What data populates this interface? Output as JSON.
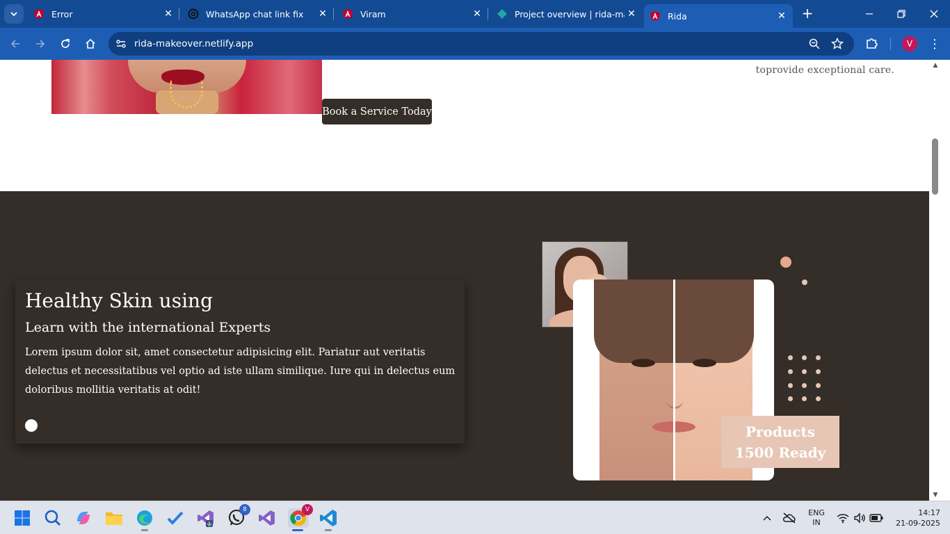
{
  "browser": {
    "tabs": [
      {
        "title": "Error",
        "favicon": "angular-icon",
        "active": false
      },
      {
        "title": "WhatsApp chat link fix",
        "favicon": "openai-icon",
        "active": false
      },
      {
        "title": "Viram",
        "favicon": "angular-icon",
        "active": false
      },
      {
        "title": "Project overview | rida-make",
        "favicon": "netlify-icon",
        "active": false
      },
      {
        "title": "Rida",
        "favicon": "angular-icon",
        "active": true
      }
    ],
    "url": "rida-makeover.netlify.app",
    "profile_initial": "V"
  },
  "page": {
    "book_button": "Book a Service Today",
    "care_text": "toprovide exceptional care.",
    "feature": {
      "title": "Healthy Skin using",
      "subtitle": "Learn with the international Experts",
      "body": "Lorem ipsum dolor sit, amet consectetur adipisicing elit. Pariatur aut veritatis delectus et necessitatibus vel optio ad iste ullam similique. Iure qui in delectus eum doloribus mollitia veritatis at odit!"
    },
    "badge": {
      "line1": "Products",
      "line2": "1500 Ready"
    },
    "colors": {
      "dark_bg": "#342d28",
      "accent_peach": "#e7c6b6"
    }
  },
  "taskbar": {
    "apps": [
      "windows-start-icon",
      "search-icon",
      "copilot-icon",
      "file-explorer-icon",
      "edge-icon",
      "todo-icon",
      "visual-studio-icon",
      "whatsapp-icon",
      "visual-studio-alt-icon",
      "chrome-icon",
      "vscode-icon"
    ],
    "whatsapp_badge": "8",
    "chrome_badge": "V",
    "language_line1": "ENG",
    "language_line2": "IN",
    "time": "14:17",
    "date": "21-09-2025"
  }
}
